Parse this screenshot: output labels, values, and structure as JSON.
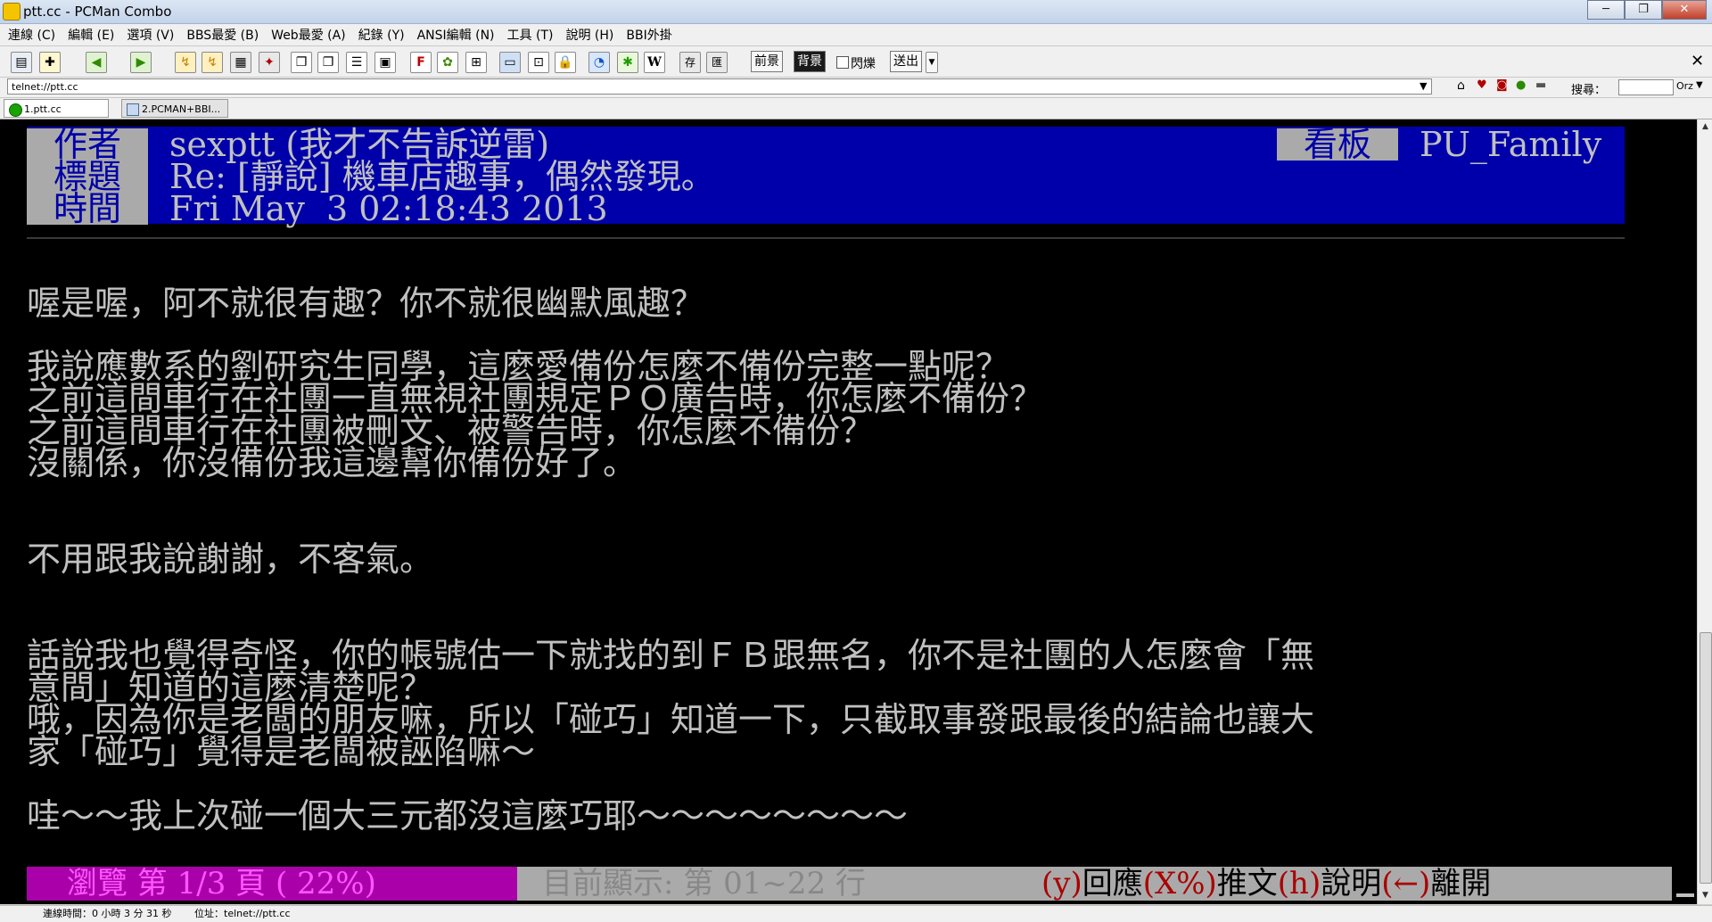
{
  "window": {
    "title": "ptt.cc - PCMan Combo",
    "controls": [
      "─",
      "❐",
      "✕"
    ]
  },
  "menu": [
    "連線 (C)",
    "編輯 (E)",
    "選項 (V)",
    "BBS最愛 (B)",
    "Web最愛 (A)",
    "紀錄 (Y)",
    "ANSI編輯 (N)",
    "工具 (T)",
    "說明 (H)",
    "BBI外掛"
  ],
  "toolbar": {
    "fg_label": "前景",
    "bg_label": "背景",
    "blink_label": "閃爍",
    "send_label": "送出",
    "close_glyph": "✕"
  },
  "address": {
    "value": "telnet://ptt.cc",
    "search_label": "搜尋：",
    "search_value": "",
    "orz_label": "Orz"
  },
  "tabs": [
    {
      "label": "1.ptt.cc",
      "active": true
    },
    {
      "label": "2.PCMAN+BBI...",
      "active": false
    }
  ],
  "article": {
    "labels": {
      "author": "作者",
      "title": "標題",
      "time": "時間",
      "board": "看板"
    },
    "author": "sexptt (我才不告訴逆雷)",
    "title": "Re: [靜說] 機車店趣事，偶然發現。",
    "time": "Fri May  3 02:18:43 2013",
    "board": "PU_Family",
    "lines": [
      "喔是喔，阿不就很有趣？你不就很幽默風趣？",
      "我說應數系的劉研究生同學，這麼愛備份怎麼不備份完整一點呢？",
      "之前這間車行在社團一直無視社團規定ＰＯ廣告時，你怎麼不備份？",
      "之前這間車行在社團被刪文、被警告時，你怎麼不備份？",
      "沒關係，你沒備份我這邊幫你備份好了。",
      "不用跟我說謝謝，不客氣。",
      "話說我也覺得奇怪，你的帳號估一下就找的到ＦＢ跟無名，你不是社團的人怎麼會「無",
      "意間」知道的這麼清楚呢？",
      "哦，因為你是老闆的朋友嘛，所以「碰巧」知道一下，只截取事發跟最後的結論也讓大",
      "家「碰巧」覺得是老闆被誣陷嘛～",
      "哇～～我上次碰一個大三元都沒這麼巧耶～～～～～～～～"
    ]
  },
  "pager": {
    "browse": "瀏覽 第 1/3 頁 ( 22%)",
    "current": "目前顯示: 第 01~22 行",
    "k_reply": "(y)",
    "reply": "回應",
    "k_push": "(X%)",
    "push": "推文",
    "k_help": "(h)",
    "help": "說明",
    "k_leave": "(←)",
    "leave": "離開"
  },
  "statusbar": {
    "connected_time": "連線時間：0 小時 3 分 31 秒",
    "location": "位址：telnet://ptt.cc"
  }
}
